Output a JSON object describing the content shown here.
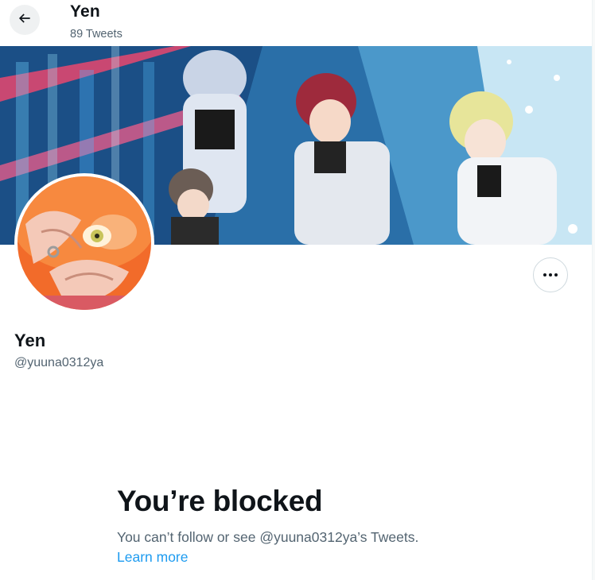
{
  "header": {
    "name": "Yen",
    "tweet_count": "89 Tweets"
  },
  "icons": {
    "back": "arrow-left-icon",
    "more": "more-horizontal-icon"
  },
  "profile": {
    "name": "Yen",
    "handle": "@yuuna0312ya"
  },
  "blocked": {
    "title": "You’re blocked",
    "message": "You can’t follow or see @yuuna0312ya’s Tweets.",
    "link": "Learn more"
  },
  "colors": {
    "text_primary": "#0f1419",
    "text_secondary": "#536471",
    "link": "#1d9bf0",
    "border": "#cfd9de"
  }
}
